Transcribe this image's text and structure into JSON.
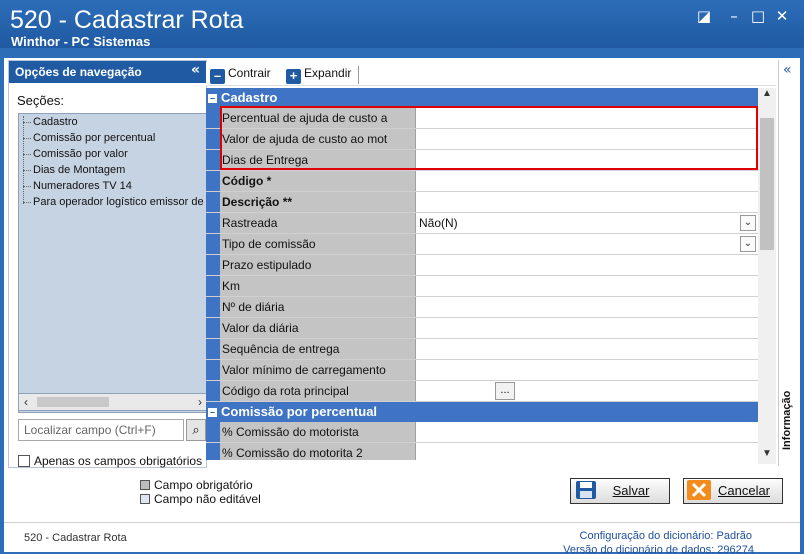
{
  "window": {
    "title": "520 - Cadastrar Rota",
    "subtitle": "Winthor - PC Sistemas"
  },
  "nav": {
    "header": "Opções de navegação",
    "sections_label": "Seções:",
    "items": [
      "Cadastro",
      "Comissão por percentual",
      "Comissão por valor",
      "Dias de Montagem",
      "Numeradores TV 14",
      "Para operador logístico emissor de"
    ],
    "search_placeholder": "Localizar campo (Ctrl+F)",
    "only_required_label": "Apenas os campos obrigatórios"
  },
  "toolbar": {
    "collapse_label": "Contrair",
    "expand_label": "Expandir"
  },
  "grid": {
    "category1": "Cadastro",
    "rows": [
      {
        "label": "Percentual de ajuda de custo a",
        "value": ""
      },
      {
        "label": "Valor de ajuda de custo ao mot",
        "value": ""
      },
      {
        "label": "Dias de Entrega",
        "value": ""
      },
      {
        "label": "Código *",
        "value": ""
      },
      {
        "label": "Descrição **",
        "value": ""
      },
      {
        "label": "Rastreada",
        "value": "Não(N)"
      },
      {
        "label": "Tipo de comissão",
        "value": ""
      },
      {
        "label": "Prazo estipulado",
        "value": ""
      },
      {
        "label": "Km",
        "value": ""
      },
      {
        "label": "Nº de diária",
        "value": ""
      },
      {
        "label": "Valor da diária",
        "value": ""
      },
      {
        "label": "Sequência de entrega",
        "value": ""
      },
      {
        "label": "Valor mínimo de carregamento",
        "value": ""
      },
      {
        "label": "Código da rota principal",
        "value": ""
      }
    ],
    "category2": "Comissão por percentual",
    "rows2": [
      {
        "label": "% Comissão do motorista",
        "value": ""
      },
      {
        "label": "% Comissão do motorita 2",
        "value": ""
      }
    ],
    "ellipsis": "..."
  },
  "info_panel": {
    "label": "Informação"
  },
  "legend": {
    "required": "Campo obrigatório",
    "not_editable": "Campo não editável"
  },
  "buttons": {
    "save": "Salvar",
    "cancel": "Cancelar"
  },
  "status": {
    "left": "520 - Cadastrar Rota",
    "dict_config": "Configuração do dicionário: Padrão",
    "dict_version": "Versão do dicionário de dados: 296274"
  },
  "colors": {
    "title_bar": "#2d6db8",
    "category": "#3f73c4",
    "highlight": "#e00000"
  }
}
